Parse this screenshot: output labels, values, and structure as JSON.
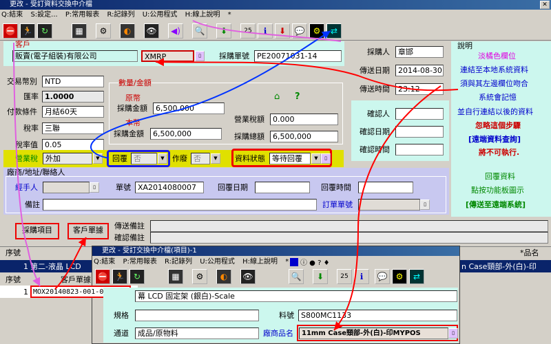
{
  "window": {
    "title": "更改 - 受訂資料交換中介檔",
    "close": "✕"
  },
  "menu": [
    "Q:結束",
    "S:設定...",
    "P:常用報表",
    "R:記錄列",
    "U:公用程式",
    "H:線上說明",
    "*"
  ],
  "form": {
    "customer_label": "客戶",
    "customer_value": "販賣(電子組裝)有限公司",
    "customer_code": "XMRP",
    "po_label": "採購單號",
    "po_value": "PE20071031-14",
    "buyer_label": "採購人",
    "buyer_value": "章邯",
    "send_date_label": "傳送日期",
    "send_date_value": "2014-08-30",
    "send_time_label": "傳送時間",
    "send_time_value": "23:12",
    "confirm_person_label": "確認人",
    "confirm_date_label": "確認日期",
    "confirm_time_label": "確認時間",
    "currency_label": "交易幣別",
    "currency_value": "NTD",
    "rate_label": "匯率",
    "rate_value": "1.0000",
    "pay_label": "付款條件",
    "pay_value": "月結60天",
    "tax_type_label": "稅率",
    "tax_type_value": "三聯",
    "tax_rate_label": "稅率值",
    "tax_rate_value": "0.05",
    "vat_label": "營業稅",
    "vat_value": "外加",
    "qty_group_label": "數量/金額",
    "orig_label": "原幣",
    "orig_amount_label": "採購金額",
    "orig_amount_value": "6,500,000",
    "local_label": "本幣",
    "local_amount_label": "採購金額",
    "local_amount_value": "6,500,000",
    "tax_amount_label": "營業稅額",
    "tax_amount_value": "0.000",
    "total_label": "採購總額",
    "total_value": "6,500,000",
    "reply_label": "回覆",
    "reply_value": "否",
    "void_label": "作廢",
    "void_value": "否",
    "status_label": "資料狀態",
    "status_value": "等待回覆",
    "vendor_group_label": "廠商/地址/聯絡人",
    "handler_label": "經手人",
    "order_no_label": "單號",
    "order_no_value": "XA2014080007",
    "reply_date_label": "回覆日期",
    "reply_time_label": "回覆時間",
    "remark_label": "備註",
    "order_code_label": "訂單單號",
    "btn_items": "採購項目",
    "btn_customer_doc": "客戶單據",
    "send_remark_label": "傳送備註",
    "confirm_remark_label": "確認備註"
  },
  "help": {
    "title": "說明",
    "lines": [
      "淡橘色欄位",
      "連結至本地系統資料",
      "須與其左邊欄位吻合",
      "系統會記憶",
      "並自行連結以後的資料",
      "忽略這個步驟",
      "[遠端資料查詢]",
      "將不可執行."
    ],
    "reply_info": "回覆資料",
    "click_hint": "點按功能板圖示",
    "send_remote": "[傳送至遠端系統]"
  },
  "grid": {
    "seq_header": "序號",
    "name_header": "*品名",
    "row1_seq": "1",
    "row1_name": "第二-液晶 LCD",
    "right_partial": "n Case頸部-外(白)-印"
  },
  "sub": {
    "title": "更改 - 受訂交換中介檔(項目)-1",
    "menu": [
      "Q:結束",
      "P:常用報表",
      "R:記錄列",
      "U:公用程式",
      "H:線上說明",
      "*"
    ],
    "seq_header": "序號",
    "doc_header": "客戶單據",
    "row_seq": "1",
    "row_doc": "MOX20140823-001-01.EMF",
    "desc_value": "幕 LCD 固定架 (銀白)-Scale",
    "spec_label": "規格",
    "part_label": "料號",
    "part_value": "S800MC1133",
    "channel_label": "通道",
    "channel_value": "成品/原物料",
    "vendor_name_label": "廠商品名",
    "vendor_name_value": "11mm Case頸部-外(白)-印MYPOS"
  }
}
